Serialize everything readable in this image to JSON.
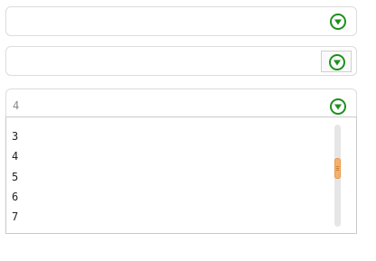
{
  "combos": [
    {
      "value": "",
      "icon": "chevron-down-circle-icon",
      "icon_color": "#1f8f1f"
    },
    {
      "value": "",
      "icon": "chevron-down-circle-icon",
      "icon_color": "#1f8f1f"
    },
    {
      "value": "4",
      "icon": "chevron-down-circle-icon",
      "icon_color": "#1f8f1f",
      "expanded": true
    }
  ],
  "dropdown": {
    "options": [
      "3",
      "4",
      "5",
      "6",
      "7"
    ],
    "scrollbar_thumb_color": "#f2b170"
  }
}
